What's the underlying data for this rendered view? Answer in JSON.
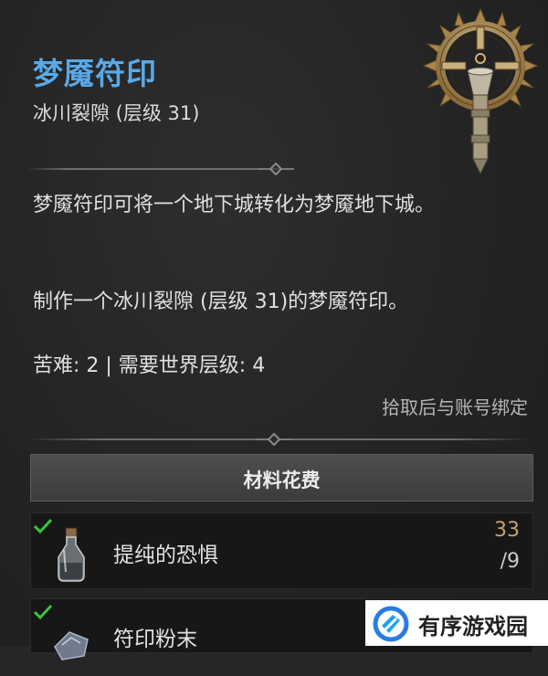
{
  "item": {
    "title": "梦魇符印",
    "subtitle": "冰川裂隙 (层级 31)",
    "description_1": "梦魇符印可将一个地下城转化为梦魇地下城。",
    "description_2": "制作一个冰川裂隙 (层级 31)的梦魇符印。",
    "stats": "苦难: 2 | 需要世界层级: 4",
    "binding": "拾取后与账号绑定"
  },
  "costs": {
    "header": "材料花费",
    "materials": [
      {
        "name": "提纯的恐惧",
        "have": "33",
        "need": "/9",
        "icon": "vial-icon",
        "met": true
      },
      {
        "name": "符印粉末",
        "have": "",
        "need": "",
        "icon": "powder-icon",
        "met": true
      }
    ]
  },
  "watermark": {
    "text": "有序游戏园"
  },
  "colors": {
    "title": "#58a9e8",
    "check": "#3cc43c",
    "have_count": "#c8a070"
  }
}
